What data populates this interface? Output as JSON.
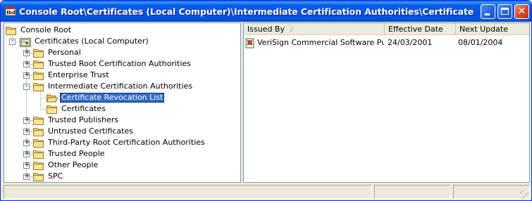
{
  "window": {
    "title": "Console Root\\Certificates (Local Computer)\\Intermediate Certification Authorities\\Certificate Revocatio...",
    "icon": "mmc-console-icon"
  },
  "tree": {
    "items": [
      {
        "label": "Console Root",
        "icon": "folder-icon",
        "depth": 0,
        "expander": ""
      },
      {
        "label": "Certificates (Local Computer)",
        "icon": "certificate-store-icon",
        "depth": 0,
        "expander": "-"
      },
      {
        "label": "Personal",
        "icon": "folder-icon",
        "depth": 1,
        "expander": "+"
      },
      {
        "label": "Trusted Root Certification Authorities",
        "icon": "folder-icon",
        "depth": 1,
        "expander": "+"
      },
      {
        "label": "Enterprise Trust",
        "icon": "folder-icon",
        "depth": 1,
        "expander": "+"
      },
      {
        "label": "Intermediate Certification Authorities",
        "icon": "folder-icon",
        "depth": 1,
        "expander": "-"
      },
      {
        "label": "Certificate Revocation List",
        "icon": "folder-open-icon",
        "depth": 2,
        "expander": "",
        "selected": true
      },
      {
        "label": "Certificates",
        "icon": "folder-icon",
        "depth": 2,
        "expander": ""
      },
      {
        "label": "Trusted Publishers",
        "icon": "folder-icon",
        "depth": 1,
        "expander": "+"
      },
      {
        "label": "Untrusted Certificates",
        "icon": "folder-icon",
        "depth": 1,
        "expander": "+"
      },
      {
        "label": "Third-Party Root Certification Authorities",
        "icon": "folder-icon",
        "depth": 1,
        "expander": "+"
      },
      {
        "label": "Trusted People",
        "icon": "folder-icon",
        "depth": 1,
        "expander": "+"
      },
      {
        "label": "Other People",
        "icon": "folder-icon",
        "depth": 1,
        "expander": "+"
      },
      {
        "label": "SPC",
        "icon": "folder-icon",
        "depth": 1,
        "expander": "+"
      }
    ]
  },
  "list": {
    "columns": [
      "Issued By",
      "Effective Date",
      "Next Update"
    ],
    "sort_indicator": "/",
    "rows": [
      {
        "icon": "crl-file-icon",
        "issued_by": "VeriSign Commercial Software Publ...",
        "effective_date": "24/03/2001",
        "next_update": "08/01/2004"
      }
    ]
  },
  "colors": {
    "titlebar": "#0453DD",
    "selection": "#316AC5",
    "window_bg": "#ECE9D8",
    "close_button": "#D74A26"
  }
}
